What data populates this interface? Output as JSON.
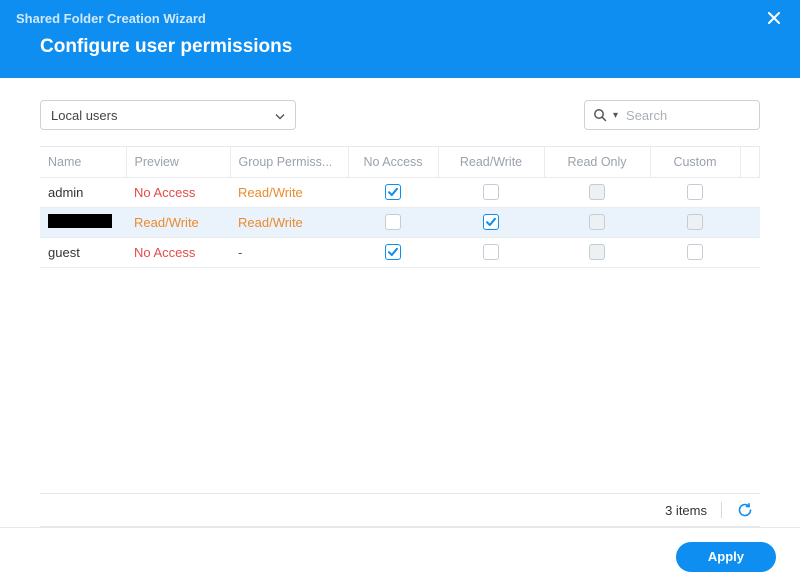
{
  "header": {
    "wizard_title": "Shared Folder Creation Wizard",
    "page_title": "Configure user permissions"
  },
  "toolbar": {
    "user_scope_selected": "Local users",
    "search_placeholder": "Search"
  },
  "table": {
    "columns": {
      "name": "Name",
      "preview": "Preview",
      "group_permissions": "Group Permiss...",
      "no_access": "No Access",
      "read_write": "Read/Write",
      "read_only": "Read Only",
      "custom": "Custom"
    },
    "rows": [
      {
        "name": "admin",
        "name_redacted": false,
        "preview": "No Access",
        "preview_kind": "no_access",
        "group_permissions": "Read/Write",
        "no_access": {
          "checked": true,
          "enabled": true
        },
        "read_write": {
          "checked": false,
          "enabled": true
        },
        "read_only": {
          "checked": false,
          "enabled": false
        },
        "custom": {
          "checked": false,
          "enabled": true
        },
        "selected": false
      },
      {
        "name": "",
        "name_redacted": true,
        "preview": "Read/Write",
        "preview_kind": "read_write",
        "group_permissions": "Read/Write",
        "no_access": {
          "checked": false,
          "enabled": true
        },
        "read_write": {
          "checked": true,
          "enabled": true
        },
        "read_only": {
          "checked": false,
          "enabled": false
        },
        "custom": {
          "checked": false,
          "enabled": false
        },
        "selected": true
      },
      {
        "name": "guest",
        "name_redacted": false,
        "preview": "No Access",
        "preview_kind": "no_access",
        "group_permissions": "-",
        "no_access": {
          "checked": true,
          "enabled": true
        },
        "read_write": {
          "checked": false,
          "enabled": true
        },
        "read_only": {
          "checked": false,
          "enabled": false
        },
        "custom": {
          "checked": false,
          "enabled": true
        },
        "selected": false
      }
    ]
  },
  "status": {
    "items_text": "3 items"
  },
  "buttons": {
    "apply": "Apply"
  }
}
